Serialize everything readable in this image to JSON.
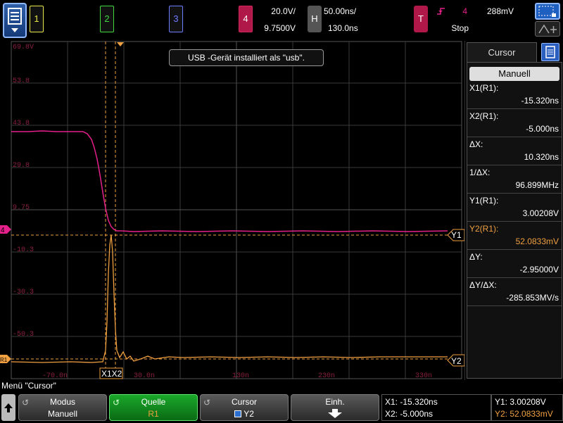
{
  "colors": {
    "ch4": "#e4208a",
    "math": "#f0a040",
    "grid": "#3a3a3a"
  },
  "top": {
    "ch1_label": "1",
    "ch2_label": "2",
    "ch3_label": "3",
    "ch4_label": "4",
    "ch4_scale": "20.0V/",
    "ch4_offset": "9.7500V",
    "h_label": "H",
    "time_scale": "50.00ns/",
    "time_delay": "130.0ns",
    "t_label": "T",
    "trig_source": "4",
    "trig_level": "288mV",
    "run_state": "Stop",
    "icons": {
      "menu": "menu-icon",
      "zoom": "zoom-box-icon",
      "cursor_tool": "cursor-tool-icon"
    }
  },
  "tooltip": "USB -Gerät installiert als \"usb\".",
  "plot": {
    "y_tick_labels": [
      "69.8V",
      "53.8",
      "43.8",
      "29.8",
      "9.75",
      "-10.3",
      "-30.3",
      "-50.3"
    ],
    "x_tick_labels": [
      "-70.0n",
      "30.0n",
      "130n",
      "230n",
      "330n"
    ],
    "markers": {
      "ch4": "4",
      "math": "R1",
      "cursor_y1": "Y1",
      "cursor_y2": "Y2",
      "cursor_x": "X1X2"
    }
  },
  "panel": {
    "tab": "Cursor",
    "mode": "Manuell",
    "rows": [
      {
        "label": "X1(R1):",
        "value": "-15.320ns"
      },
      {
        "label": "X2(R1):",
        "value": "-5.000ns"
      },
      {
        "label": "ΔX:",
        "value": "10.320ns"
      },
      {
        "label": "1/ΔX:",
        "value": "96.899MHz"
      },
      {
        "label": "Y1(R1):",
        "value": "3.00208V"
      },
      {
        "label": "Y2(R1):",
        "value": "52.0833mV",
        "highlight": true
      },
      {
        "label": "ΔY:",
        "value": "-2.95000V"
      },
      {
        "label": "ΔY/ΔX:",
        "value": "-285.853MV/s"
      }
    ]
  },
  "bottom": {
    "menu_title": "Menü \"Cursor\"",
    "keys": {
      "mode_l1": "Modus",
      "mode_l2": "Manuell",
      "source_l1": "Quelle",
      "source_l2": "R1",
      "cursor_l1": "Cursor",
      "cursor_l2": "Y2",
      "units_l1": "Einh."
    },
    "status": {
      "x1": "X1: -15.320ns",
      "x2": "X2: -5.000ns",
      "y1": "Y1: 3.00208V",
      "y2": "Y2: 52.0833mV"
    }
  }
}
